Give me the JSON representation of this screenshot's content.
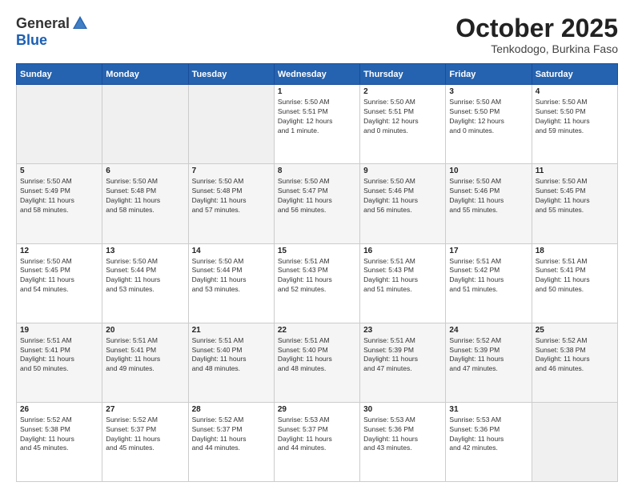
{
  "header": {
    "logo_general": "General",
    "logo_blue": "Blue",
    "month_title": "October 2025",
    "subtitle": "Tenkodogo, Burkina Faso"
  },
  "weekdays": [
    "Sunday",
    "Monday",
    "Tuesday",
    "Wednesday",
    "Thursday",
    "Friday",
    "Saturday"
  ],
  "weeks": [
    [
      {
        "day": "",
        "info": ""
      },
      {
        "day": "",
        "info": ""
      },
      {
        "day": "",
        "info": ""
      },
      {
        "day": "1",
        "info": "Sunrise: 5:50 AM\nSunset: 5:51 PM\nDaylight: 12 hours\nand 1 minute."
      },
      {
        "day": "2",
        "info": "Sunrise: 5:50 AM\nSunset: 5:51 PM\nDaylight: 12 hours\nand 0 minutes."
      },
      {
        "day": "3",
        "info": "Sunrise: 5:50 AM\nSunset: 5:50 PM\nDaylight: 12 hours\nand 0 minutes."
      },
      {
        "day": "4",
        "info": "Sunrise: 5:50 AM\nSunset: 5:50 PM\nDaylight: 11 hours\nand 59 minutes."
      }
    ],
    [
      {
        "day": "5",
        "info": "Sunrise: 5:50 AM\nSunset: 5:49 PM\nDaylight: 11 hours\nand 58 minutes."
      },
      {
        "day": "6",
        "info": "Sunrise: 5:50 AM\nSunset: 5:48 PM\nDaylight: 11 hours\nand 58 minutes."
      },
      {
        "day": "7",
        "info": "Sunrise: 5:50 AM\nSunset: 5:48 PM\nDaylight: 11 hours\nand 57 minutes."
      },
      {
        "day": "8",
        "info": "Sunrise: 5:50 AM\nSunset: 5:47 PM\nDaylight: 11 hours\nand 56 minutes."
      },
      {
        "day": "9",
        "info": "Sunrise: 5:50 AM\nSunset: 5:46 PM\nDaylight: 11 hours\nand 56 minutes."
      },
      {
        "day": "10",
        "info": "Sunrise: 5:50 AM\nSunset: 5:46 PM\nDaylight: 11 hours\nand 55 minutes."
      },
      {
        "day": "11",
        "info": "Sunrise: 5:50 AM\nSunset: 5:45 PM\nDaylight: 11 hours\nand 55 minutes."
      }
    ],
    [
      {
        "day": "12",
        "info": "Sunrise: 5:50 AM\nSunset: 5:45 PM\nDaylight: 11 hours\nand 54 minutes."
      },
      {
        "day": "13",
        "info": "Sunrise: 5:50 AM\nSunset: 5:44 PM\nDaylight: 11 hours\nand 53 minutes."
      },
      {
        "day": "14",
        "info": "Sunrise: 5:50 AM\nSunset: 5:44 PM\nDaylight: 11 hours\nand 53 minutes."
      },
      {
        "day": "15",
        "info": "Sunrise: 5:51 AM\nSunset: 5:43 PM\nDaylight: 11 hours\nand 52 minutes."
      },
      {
        "day": "16",
        "info": "Sunrise: 5:51 AM\nSunset: 5:43 PM\nDaylight: 11 hours\nand 51 minutes."
      },
      {
        "day": "17",
        "info": "Sunrise: 5:51 AM\nSunset: 5:42 PM\nDaylight: 11 hours\nand 51 minutes."
      },
      {
        "day": "18",
        "info": "Sunrise: 5:51 AM\nSunset: 5:41 PM\nDaylight: 11 hours\nand 50 minutes."
      }
    ],
    [
      {
        "day": "19",
        "info": "Sunrise: 5:51 AM\nSunset: 5:41 PM\nDaylight: 11 hours\nand 50 minutes."
      },
      {
        "day": "20",
        "info": "Sunrise: 5:51 AM\nSunset: 5:41 PM\nDaylight: 11 hours\nand 49 minutes."
      },
      {
        "day": "21",
        "info": "Sunrise: 5:51 AM\nSunset: 5:40 PM\nDaylight: 11 hours\nand 48 minutes."
      },
      {
        "day": "22",
        "info": "Sunrise: 5:51 AM\nSunset: 5:40 PM\nDaylight: 11 hours\nand 48 minutes."
      },
      {
        "day": "23",
        "info": "Sunrise: 5:51 AM\nSunset: 5:39 PM\nDaylight: 11 hours\nand 47 minutes."
      },
      {
        "day": "24",
        "info": "Sunrise: 5:52 AM\nSunset: 5:39 PM\nDaylight: 11 hours\nand 47 minutes."
      },
      {
        "day": "25",
        "info": "Sunrise: 5:52 AM\nSunset: 5:38 PM\nDaylight: 11 hours\nand 46 minutes."
      }
    ],
    [
      {
        "day": "26",
        "info": "Sunrise: 5:52 AM\nSunset: 5:38 PM\nDaylight: 11 hours\nand 45 minutes."
      },
      {
        "day": "27",
        "info": "Sunrise: 5:52 AM\nSunset: 5:37 PM\nDaylight: 11 hours\nand 45 minutes."
      },
      {
        "day": "28",
        "info": "Sunrise: 5:52 AM\nSunset: 5:37 PM\nDaylight: 11 hours\nand 44 minutes."
      },
      {
        "day": "29",
        "info": "Sunrise: 5:53 AM\nSunset: 5:37 PM\nDaylight: 11 hours\nand 44 minutes."
      },
      {
        "day": "30",
        "info": "Sunrise: 5:53 AM\nSunset: 5:36 PM\nDaylight: 11 hours\nand 43 minutes."
      },
      {
        "day": "31",
        "info": "Sunrise: 5:53 AM\nSunset: 5:36 PM\nDaylight: 11 hours\nand 42 minutes."
      },
      {
        "day": "",
        "info": ""
      }
    ]
  ]
}
